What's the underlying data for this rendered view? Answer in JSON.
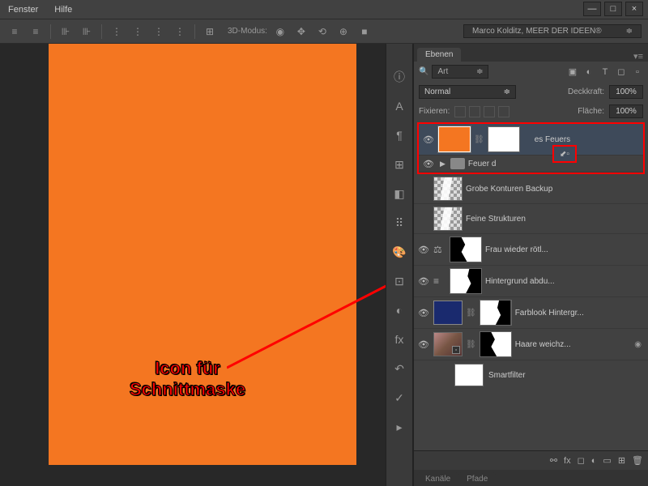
{
  "menubar": {
    "fenster": "Fenster",
    "hilfe": "Hilfe"
  },
  "toolbar": {
    "mode_label": "3D-Modus:",
    "author": "Marco Kolditz, MEER DER IDEEN®"
  },
  "annotation": {
    "line1": "Icon für",
    "line2": "Schnittmaske"
  },
  "panel_tabs": {
    "ebenen": "Ebenen",
    "kanale": "Kanäle",
    "pfade": "Pfade"
  },
  "filter_row": {
    "search_placeholder": "Art"
  },
  "blend": {
    "mode": "Normal",
    "opacity_label": "Deckkraft:",
    "opacity_value": "100%"
  },
  "lock": {
    "label": "Fixieren:",
    "fill_label": "Fläche:",
    "fill_value": "100%"
  },
  "layers": {
    "fire_color": "es Feuers",
    "fire_group": "Feuer d",
    "konturen": "Grobe Konturen Backup",
    "fein": "Feine Strukturen",
    "frau": "Frau wieder rötl...",
    "hintergrund": "Hintergrund abdu...",
    "farblook": "Farblook Hintergr...",
    "haare": "Haare weichz...",
    "smartfilter": "Smartfilter"
  },
  "footer": {
    "fx": "fx"
  },
  "window": {
    "minimize": "—",
    "maximize": "□",
    "close": "×"
  }
}
